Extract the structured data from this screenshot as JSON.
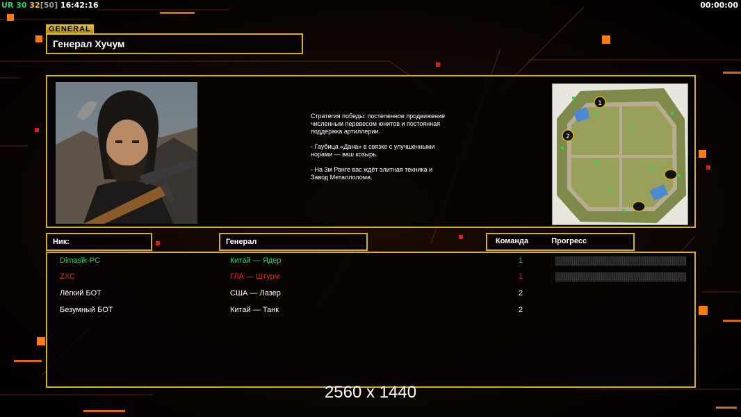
{
  "hud": {
    "prefix": "UR",
    "n1": "30",
    "n2": "32",
    "bracket_open": "[",
    "n3": "50",
    "bracket_close": "]",
    "clock": "16:42:16",
    "timer": "00:00:00"
  },
  "general": {
    "tag": "GENERAL",
    "name": "Генерал Хучум",
    "description": [
      "Стратегия победы: постепенное продвижение численным перевесом юнитов и постоянная поддержка артиллерии.",
      "- Гаубица «Дана» в связке с улучшенными норами — ваш козырь.",
      "- На 3м Ранге вас ждёт элитная техника и Завод Металлолома."
    ]
  },
  "minimap": {
    "markers": [
      "1",
      "2"
    ]
  },
  "table": {
    "headers": {
      "nick": "Ник:",
      "general": "Генерал",
      "team": "Команда",
      "progress": "Прогресс"
    },
    "players": [
      {
        "nick": "Dimasik-PC",
        "general": "Китай — Ядер",
        "team": "1",
        "color": "#27d36a",
        "team_color": "#27d36a"
      },
      {
        "nick": "ZXC",
        "general": "ГЛА — Штурм",
        "team": "1",
        "color": "#e0261a",
        "team_color": "#e0261a"
      },
      {
        "nick": "Лёгкий БОТ",
        "general": "США — Лазер",
        "team": "2",
        "color": "#ffffff",
        "team_color": "#ffffff"
      },
      {
        "nick": "Безумный БОТ",
        "general": "Китай — Танк",
        "team": "2",
        "color": "#ffffff",
        "team_color": "#ffffff"
      }
    ]
  },
  "resolution": "2560 x 1440",
  "colors": {
    "accent": "#d6b21a",
    "hud_green": "#27d36a",
    "hud_yellow": "#f2d21a",
    "hud_gray": "#9a9a9a"
  }
}
